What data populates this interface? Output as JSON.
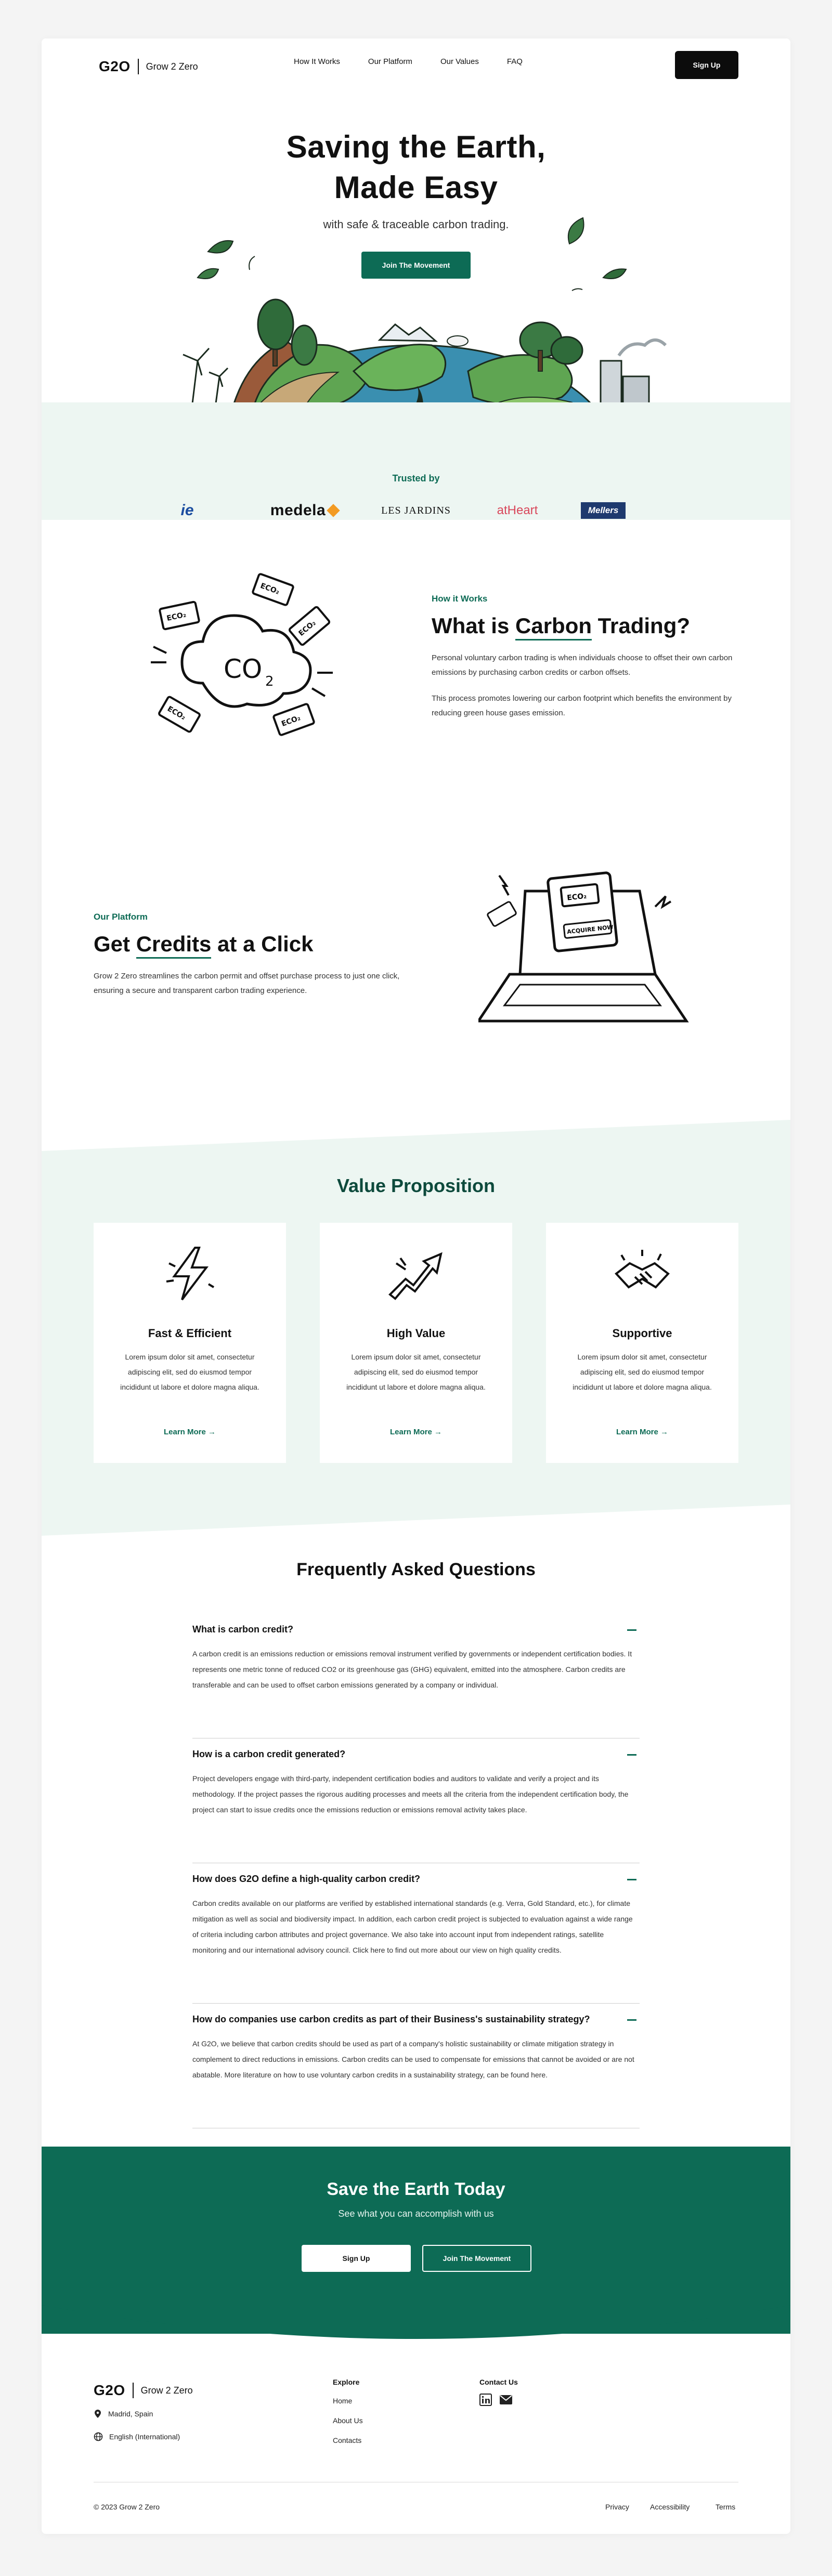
{
  "brand": {
    "mark": "G2O",
    "name": "Grow 2 Zero",
    "accent": "#0d6b55"
  },
  "nav": {
    "links": [
      "How It Works",
      "Our Platform",
      "Our Values",
      "FAQ"
    ],
    "signup": "Sign Up"
  },
  "hero": {
    "title_line1": "Saving the Earth,",
    "title_line2": "Made Easy",
    "subtitle": "with safe & traceable carbon trading.",
    "cta": "Join The Movement"
  },
  "trusted": {
    "title": "Trusted by",
    "logos": [
      "ie",
      "medela",
      "LES JARDINS",
      "atHeart",
      "Mellers"
    ]
  },
  "how": {
    "tag": "How it Works",
    "title_pre": "What is ",
    "title_hl": "Carbon",
    "title_post": " Trading?",
    "p1": "Personal voluntary carbon trading is when individuals choose to offset their own carbon emissions by purchasing carbon credits or carbon offsets.",
    "p2": "This process promotes lowering our carbon footprint which benefits the environment by reducing green house gases emission.",
    "ticket_label": "ECO₂"
  },
  "platform": {
    "tag": "Our Platform",
    "title_pre": "Get ",
    "title_hl": "Credits",
    "title_post": " at a Click",
    "p1": "Grow 2 Zero streamlines the carbon permit and offset purchase process to just one click, ensuring a secure and transparent carbon trading experience.",
    "screen_button": "ACQUIRE NOW"
  },
  "values": {
    "title": "Value Proposition",
    "cards": [
      {
        "icon": "lightning-icon",
        "title": "Fast & Efficient",
        "text": "Lorem ipsum dolor sit amet, consectetur adipiscing elit, sed do eiusmod tempor incididunt ut labore et dolore magna aliqua.",
        "link": "Learn More"
      },
      {
        "icon": "growth-arrow-icon",
        "title": "High Value",
        "text": "Lorem ipsum dolor sit amet, consectetur adipiscing elit, sed do eiusmod tempor incididunt ut labore et dolore magna aliqua.",
        "link": "Learn More"
      },
      {
        "icon": "handshake-icon",
        "title": "Supportive",
        "text": "Lorem ipsum dolor sit amet, consectetur adipiscing elit, sed do eiusmod tempor incididunt ut labore et dolore magna aliqua.",
        "link": "Learn More"
      }
    ]
  },
  "faq": {
    "title": "Frequently Asked Questions",
    "items": [
      {
        "q": "What is carbon credit?",
        "a": "A carbon credit is an emissions reduction or emissions removal instrument verified by governments or independent certification bodies. It represents one metric tonne of reduced CO2 or its greenhouse gas (GHG) equivalent, emitted into the atmosphere. Carbon credits are transferable and can be used to offset carbon emissions generated by a company or individual."
      },
      {
        "q": "How is a carbon credit generated?",
        "a": "Project developers engage with third-party, independent certification bodies and auditors to validate and verify a project and its methodology. If the project passes the rigorous auditing processes and meets all the criteria from the independent certification body, the project can start to issue credits once the emissions reduction or emissions removal activity takes place."
      },
      {
        "q": "How does G2O define a high-quality carbon credit?",
        "a": "Carbon credits available on our platforms are verified by established international standards (e.g. Verra, Gold Standard, etc.), for climate mitigation as well as social and biodiversity impact. In addition, each carbon credit project is subjected to evaluation against a wide range of criteria including carbon attributes and project governance. We also take into account input from independent ratings, satellite monitoring and our international advisory council. Click here to find out more about our view on high quality credits."
      },
      {
        "q": "How do companies use carbon credits as part of their Business's sustainability strategy?",
        "a": "At G2O, we believe that carbon credits should be used as part of a company's holistic sustainability or climate mitigation strategy in complement to direct reductions in emissions. Carbon credits can be used to compensate for emissions that cannot be avoided or are not abatable. More literature on how to use voluntary carbon credits in a sustainability strategy, can be found here."
      }
    ]
  },
  "cta": {
    "title": "Save the Earth Today",
    "subtitle": "See what you can accomplish with us",
    "signup": "Sign Up",
    "join": "Join The Movement"
  },
  "footer": {
    "location": "Madrid, Spain",
    "language": "English (International)",
    "explore_title": "Explore",
    "explore_links": [
      "Home",
      "About Us",
      "Contacts"
    ],
    "contact_title": "Contact Us",
    "copyright": "© 2023 Grow 2 Zero",
    "legal": [
      "Privacy",
      "Accessibility",
      "Terms"
    ]
  }
}
